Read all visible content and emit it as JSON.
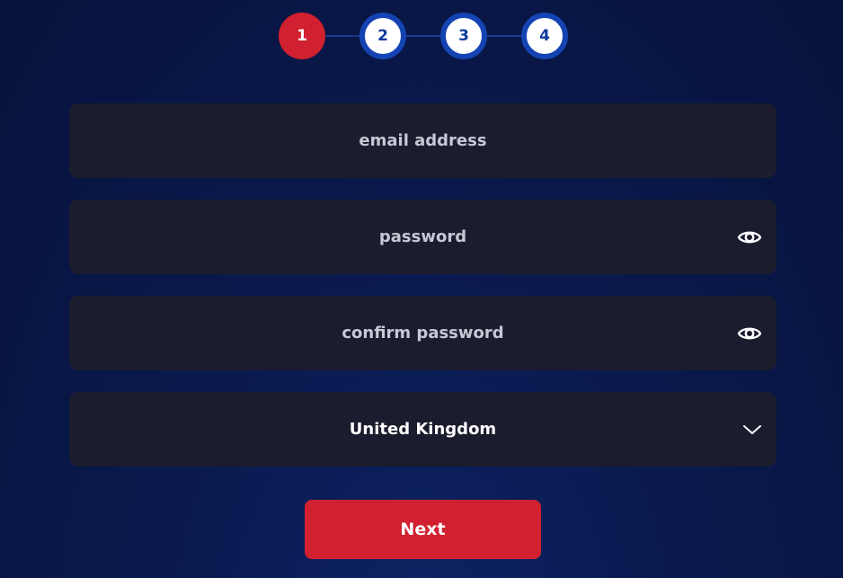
{
  "stepper": {
    "steps": [
      {
        "label": "1",
        "state": "active"
      },
      {
        "label": "2",
        "state": "inactive"
      },
      {
        "label": "3",
        "state": "inactive"
      },
      {
        "label": "4",
        "state": "inactive"
      }
    ]
  },
  "form": {
    "email": {
      "placeholder": "email address",
      "value": ""
    },
    "password": {
      "placeholder": "password",
      "value": "",
      "toggle_icon": "eye-icon"
    },
    "confirm_password": {
      "placeholder": "confirm password",
      "value": "",
      "toggle_icon": "eye-icon"
    },
    "country": {
      "selected": "United Kingdom",
      "icon": "chevron-down-icon"
    }
  },
  "next_label": "Next",
  "colors": {
    "accent_red": "#d1202f",
    "step_blue": "#1444b3",
    "field_bg": "#1b1c2d",
    "page_bg": "#0a1a4f"
  }
}
